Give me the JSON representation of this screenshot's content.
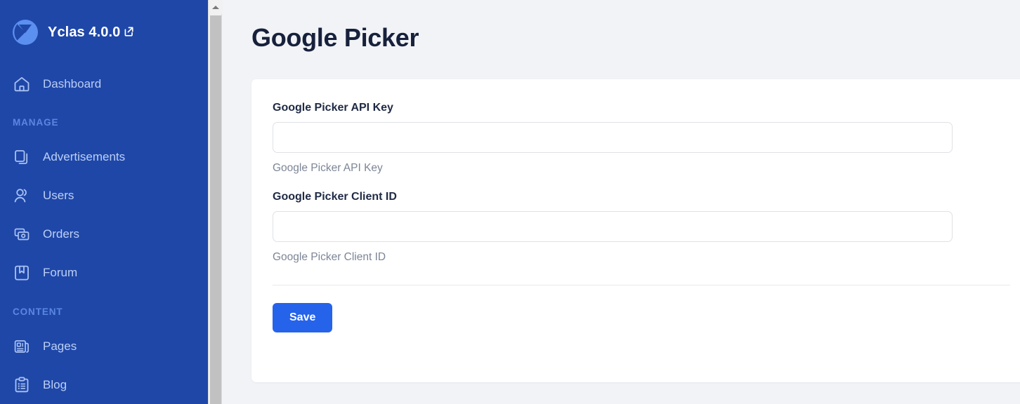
{
  "sidebar": {
    "brand": {
      "name": "Yclas 4.0.0",
      "logo_icon": "yclas-logo-icon",
      "external_link_icon": "external-link-icon"
    },
    "primary_items": [
      {
        "label": "Dashboard",
        "icon": "home-icon"
      }
    ],
    "sections": [
      {
        "title": "MANAGE",
        "items": [
          {
            "label": "Advertisements",
            "icon": "copy-documents-icon"
          },
          {
            "label": "Users",
            "icon": "users-icon"
          },
          {
            "label": "Orders",
            "icon": "money-bills-icon"
          },
          {
            "label": "Forum",
            "icon": "bookmark-book-icon"
          }
        ]
      },
      {
        "title": "CONTENT",
        "items": [
          {
            "label": "Pages",
            "icon": "newspaper-icon"
          },
          {
            "label": "Blog",
            "icon": "clipboard-list-icon"
          }
        ]
      }
    ],
    "colors": {
      "background": "#1f47a8",
      "label": "#bcd0f5",
      "section_title": "#5b87e0"
    }
  },
  "scrollbar": {
    "up_arrow_icon": "scroll-up-arrow-icon",
    "thumb_name": "scrollbar-thumb"
  },
  "main": {
    "page_title": "Google Picker",
    "form": {
      "fields": [
        {
          "label": "Google Picker API Key",
          "value": "",
          "placeholder": "",
          "help": "Google Picker API Key"
        },
        {
          "label": "Google Picker Client ID",
          "value": "",
          "placeholder": "",
          "help": "Google Picker Client ID"
        }
      ],
      "save_label": "Save",
      "save_color": "#2563eb"
    }
  }
}
